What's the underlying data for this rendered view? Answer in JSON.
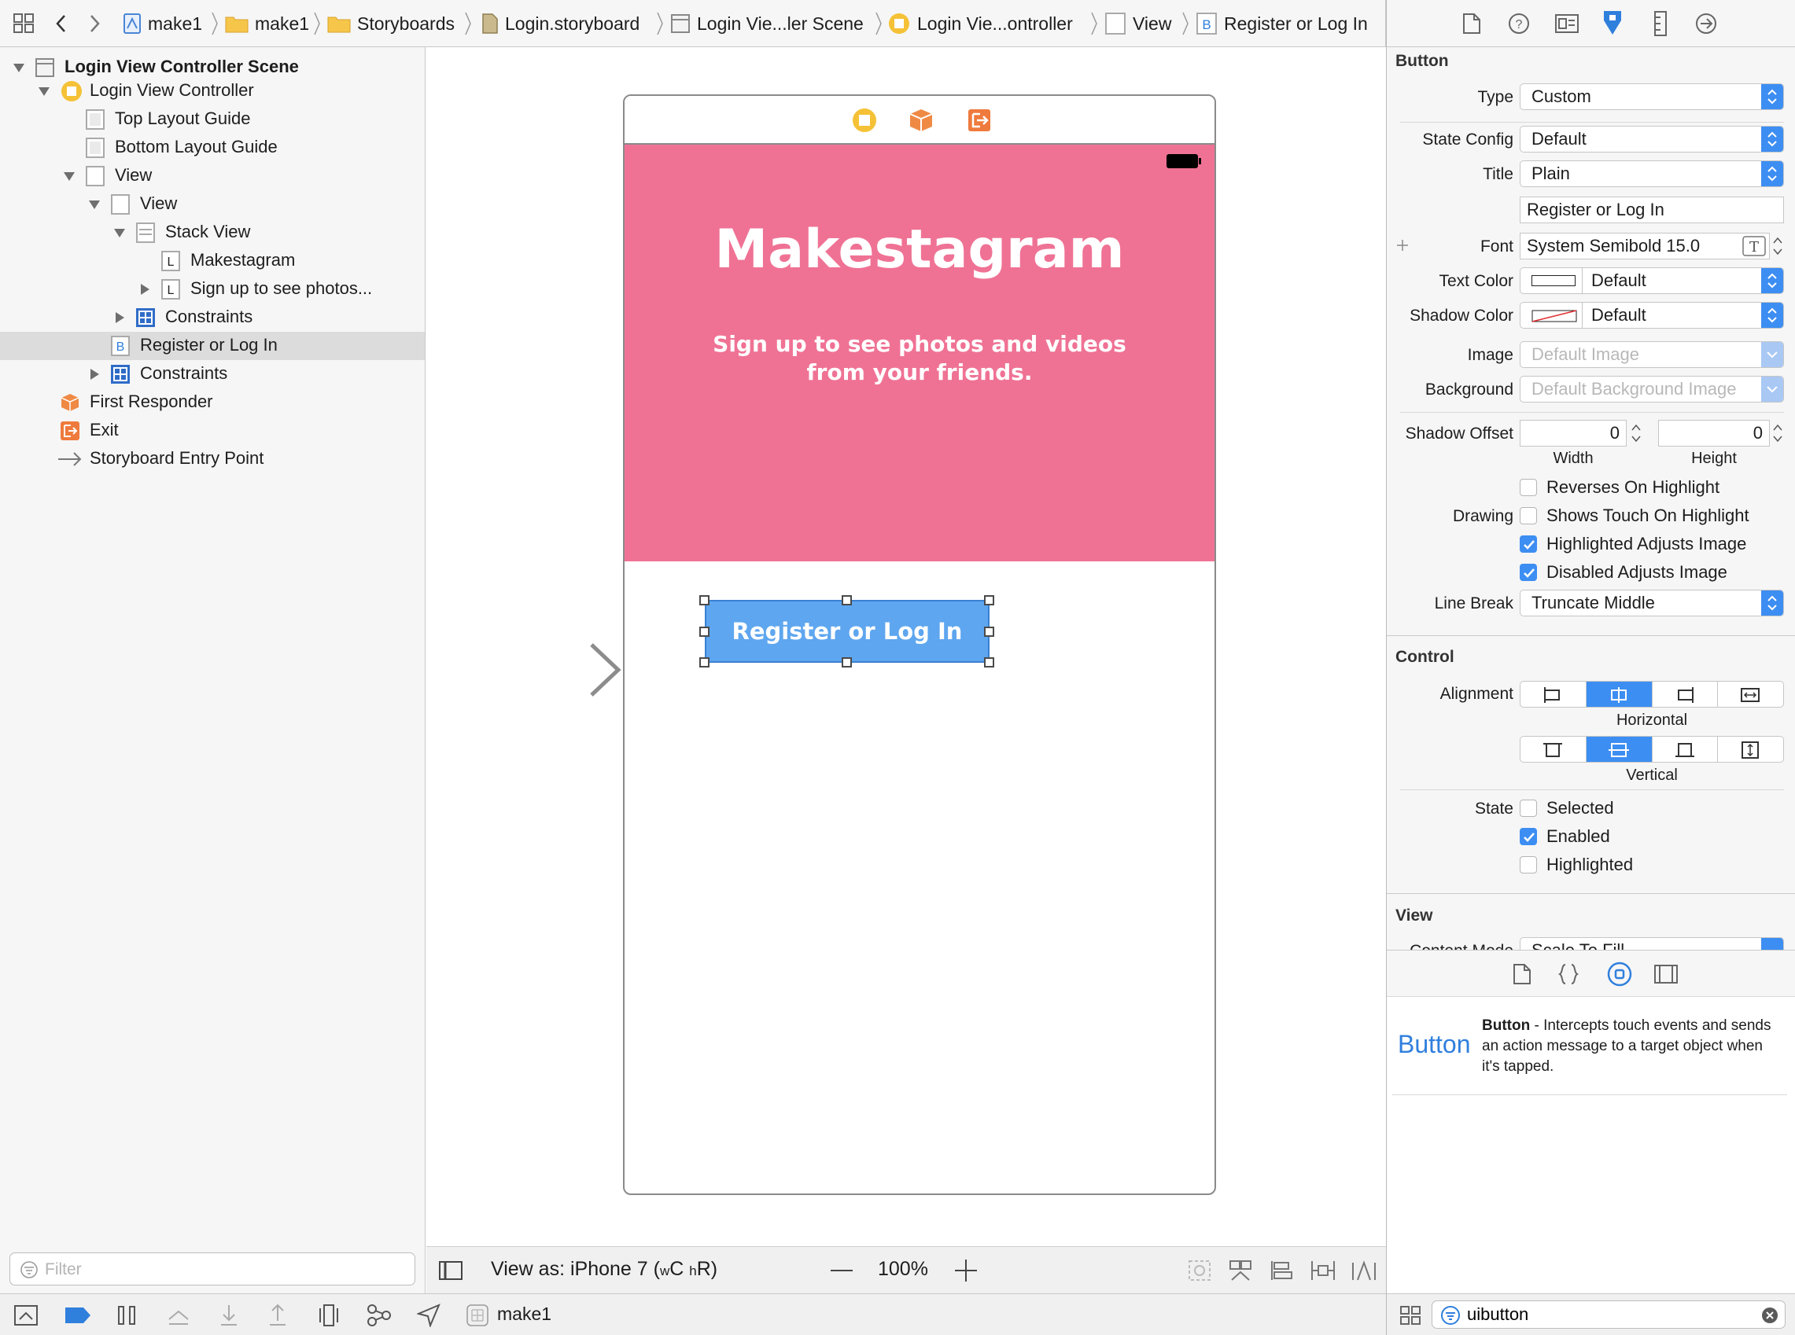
{
  "jumpbar": {
    "crumbs": [
      "make1",
      "make1",
      "Storyboards",
      "Login.storyboard",
      "Login Vie...ler Scene",
      "Login Vie...ontroller",
      "View",
      "Register or Log In"
    ]
  },
  "outline": {
    "items": [
      {
        "label": "Login View Controller Scene"
      },
      {
        "label": "Login View Controller"
      },
      {
        "label": "Top Layout Guide"
      },
      {
        "label": "Bottom Layout Guide"
      },
      {
        "label": "View"
      },
      {
        "label": "View"
      },
      {
        "label": "Stack View"
      },
      {
        "label": "Makestagram"
      },
      {
        "label": "Sign up to see photos..."
      },
      {
        "label": "Constraints"
      },
      {
        "label": "Register or Log In"
      },
      {
        "label": "Constraints"
      },
      {
        "label": "First Responder"
      },
      {
        "label": "Exit"
      },
      {
        "label": "Storyboard Entry Point"
      }
    ],
    "filter_placeholder": "Filter"
  },
  "canvas": {
    "app_title": "Makestagram",
    "app_subtitle": "Sign up to see photos and videos from your friends.",
    "button_label": "Register or Log In",
    "view_as": "View as: iPhone 7 (",
    "size_w": "w",
    "size_C": "C",
    "size_h": "h",
    "size_R": "R)",
    "zoom": "100%",
    "pink_color": "#ef7294",
    "button_color": "#5ea6ef"
  },
  "inspector": {
    "button_section": "Button",
    "type_label": "Type",
    "type_value": "Custom",
    "state_config_label": "State Config",
    "state_config_value": "Default",
    "title_label": "Title",
    "title_value": "Plain",
    "title_text": "Register or Log In",
    "font_label": "Font",
    "font_value": "System Semibold 15.0",
    "text_color_label": "Text Color",
    "text_color_value": "Default",
    "shadow_color_label": "Shadow Color",
    "shadow_color_value": "Default",
    "image_label": "Image",
    "image_placeholder": "Default Image",
    "background_label": "Background",
    "background_placeholder": "Default Background Image",
    "shadow_offset_label": "Shadow Offset",
    "shadow_w": "0",
    "shadow_h": "0",
    "width_caption": "Width",
    "height_caption": "Height",
    "drawing_label": "Drawing",
    "drawing_options": [
      {
        "label": "Reverses On Highlight",
        "checked": false
      },
      {
        "label": "Shows Touch On Highlight",
        "checked": false
      },
      {
        "label": "Highlighted Adjusts Image",
        "checked": true
      },
      {
        "label": "Disabled Adjusts Image",
        "checked": true
      }
    ],
    "line_break_label": "Line Break",
    "line_break_value": "Truncate Middle",
    "control_section": "Control",
    "alignment_label": "Alignment",
    "horizontal_caption": "Horizontal",
    "vertical_caption": "Vertical",
    "state_label": "State",
    "state_options": [
      {
        "label": "Selected",
        "checked": false
      },
      {
        "label": "Enabled",
        "checked": true
      },
      {
        "label": "Highlighted",
        "checked": false
      }
    ],
    "view_section": "View",
    "content_mode_label": "Content Mode",
    "content_mode_value": "Scale To Fill"
  },
  "library": {
    "name": "Button",
    "desc_title": "Button",
    "desc_body": " - Intercepts touch events and sends an action message to a target object when it's tapped.",
    "search_value": "uibutton"
  },
  "bottombar": {
    "target": "make1"
  },
  "colors": {
    "accent": "#3d8ef2",
    "selection": "#dcdcdc"
  }
}
